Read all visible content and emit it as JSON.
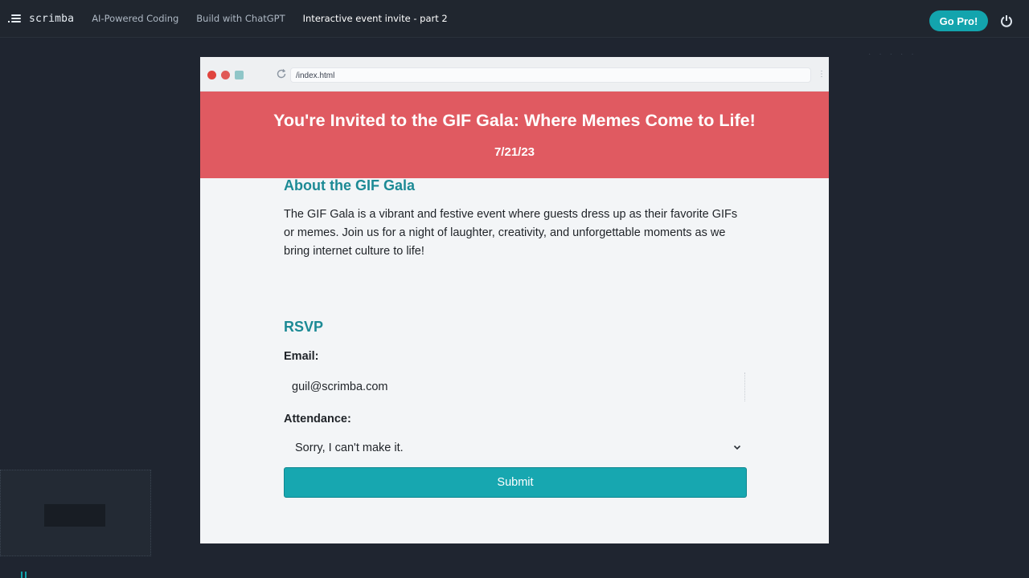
{
  "nav": {
    "brand": "scrimba",
    "crumbs": [
      "AI-Powered Coding",
      "Build with ChatGPT",
      "Interactive event invite - part 2"
    ],
    "go_pro": "Go Pro!"
  },
  "browser": {
    "url": "/index.html"
  },
  "page": {
    "title": "You're Invited to the GIF Gala: Where Memes Come to Life!",
    "date": "7/21/23",
    "about_heading": "About the GIF Gala",
    "about_text": "The GIF Gala is a vibrant and festive event where guests dress up as their favorite GIFs or memes. Join us for a night of laughter, creativity, and unforgettable moments as we bring internet culture to life!",
    "rsvp_heading": "RSVP",
    "email_label": "Email:",
    "email_value": "guil@scrimba.com",
    "attendance_label": "Attendance:",
    "attendance_value": "Sorry, I can't make it.",
    "submit_label": "Submit"
  },
  "colors": {
    "header_bg": "#e05a61",
    "accent": "#17a7b0",
    "heading": "#1c8a95"
  }
}
